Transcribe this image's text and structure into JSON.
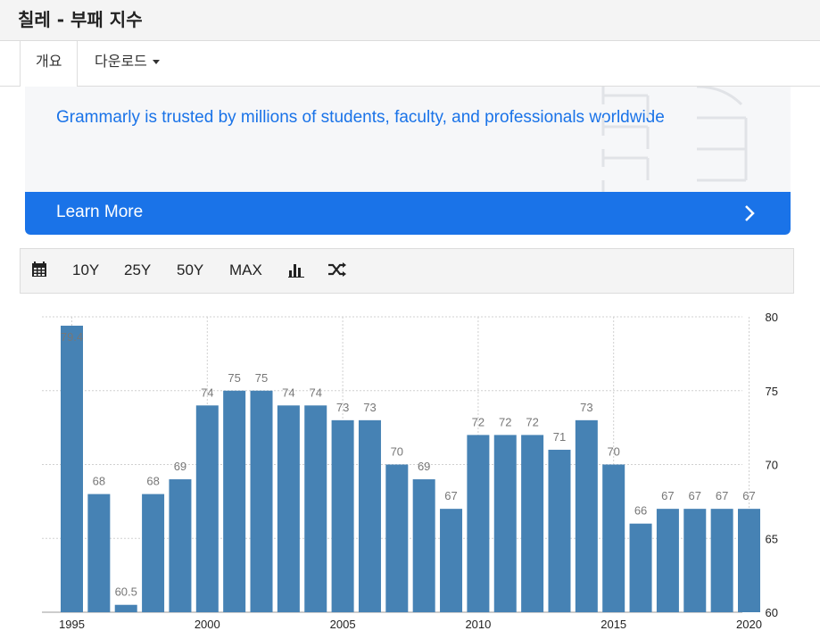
{
  "header": {
    "title": "칠레 - 부패 지수"
  },
  "tabs": [
    {
      "label": "개요",
      "active": true
    },
    {
      "label": "다운로드",
      "active": false
    }
  ],
  "ad": {
    "text": "Grammarly is trusted by millions of students, faculty, and professionals worldwide",
    "button_label": "Learn More",
    "brand_color": "#1a73e8"
  },
  "toolbar": {
    "calendar_icon": "calendar-icon",
    "ranges": [
      "10Y",
      "25Y",
      "50Y",
      "MAX"
    ],
    "bar_chart_icon": "bar-chart-icon",
    "shuffle_icon": "shuffle-icon"
  },
  "chart_data": {
    "type": "bar",
    "title": "",
    "xlabel": "",
    "ylabel": "",
    "ylim": [
      60,
      80
    ],
    "yticks": [
      60,
      65,
      70,
      75,
      80
    ],
    "xticks": [
      1995,
      2000,
      2005,
      2010,
      2015,
      2020
    ],
    "categories": [
      1995,
      1996,
      1997,
      1998,
      1999,
      2000,
      2001,
      2002,
      2003,
      2004,
      2005,
      2006,
      2007,
      2008,
      2009,
      2010,
      2011,
      2012,
      2013,
      2014,
      2015,
      2016,
      2017,
      2018,
      2019,
      2020
    ],
    "values": [
      79.4,
      68,
      60.5,
      68,
      69,
      74,
      75,
      75,
      74,
      74,
      73,
      73,
      70,
      69,
      67,
      72,
      72,
      72,
      71,
      73,
      70,
      66,
      67,
      67,
      67,
      67
    ],
    "value_labels": [
      "79.4",
      "68",
      "60.5",
      "68",
      "69",
      "74",
      "75",
      "75",
      "74",
      "74",
      "73",
      "73",
      "70",
      "69",
      "67",
      "72",
      "72",
      "72",
      "71",
      "73",
      "70",
      "66",
      "67",
      "67",
      "67",
      "67"
    ],
    "bar_color": "#4682b4",
    "grid": true,
    "y_axis_position": "right"
  }
}
